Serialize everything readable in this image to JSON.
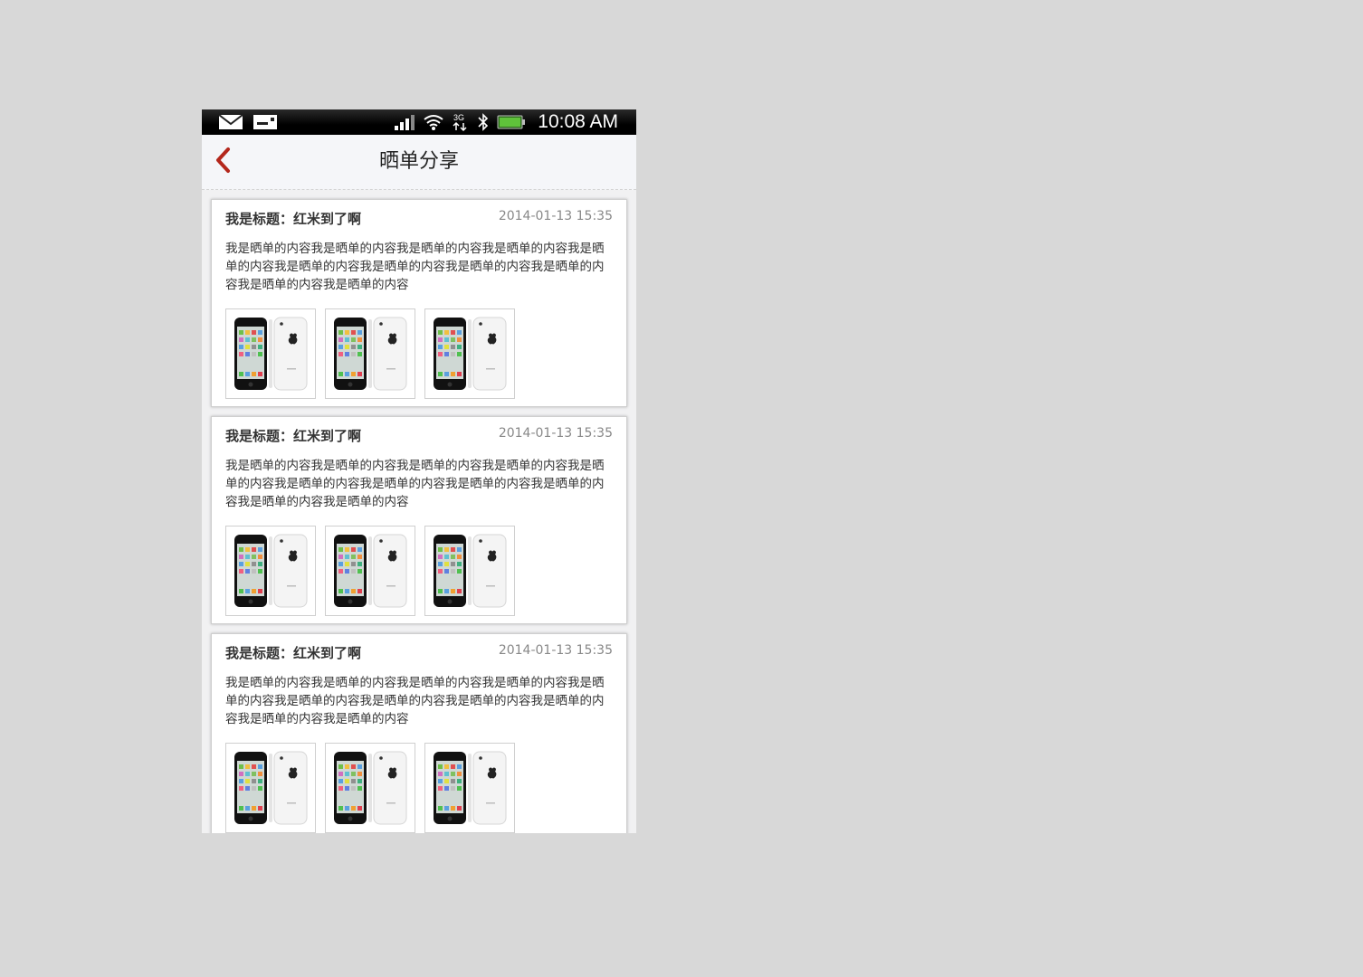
{
  "status_bar": {
    "time": "10:08 AM",
    "icons": [
      "mail-icon",
      "sim-icon",
      "signal-icon",
      "wifi-icon",
      "3g-icon",
      "bluetooth-icon",
      "battery-icon"
    ]
  },
  "header": {
    "title": "晒单分享",
    "back_icon": "chevron-left-icon",
    "accent_color": "#b4271c"
  },
  "posts": [
    {
      "title": "我是标题：红米到了啊",
      "date": "2014-01-13 15:35",
      "content": "我是晒单的内容我是晒单的内容我是晒单的内容我是晒单的内容我是晒单的内容我是晒单的内容我是晒单的内容我是晒单的内容我是晒单的内容我是晒单的内容我是晒单的内容"
    },
    {
      "title": "我是标题：红米到了啊",
      "date": "2014-01-13 15:35",
      "content": "我是晒单的内容我是晒单的内容我是晒单的内容我是晒单的内容我是晒单的内容我是晒单的内容我是晒单的内容我是晒单的内容我是晒单的内容我是晒单的内容我是晒单的内容"
    },
    {
      "title": "我是标题：红米到了啊",
      "date": "2014-01-13 15:35",
      "content": "我是晒单的内容我是晒单的内容我是晒单的内容我是晒单的内容我是晒单的内容我是晒单的内容我是晒单的内容我是晒单的内容我是晒单的内容我是晒单的内容我是晒单的内容"
    }
  ]
}
